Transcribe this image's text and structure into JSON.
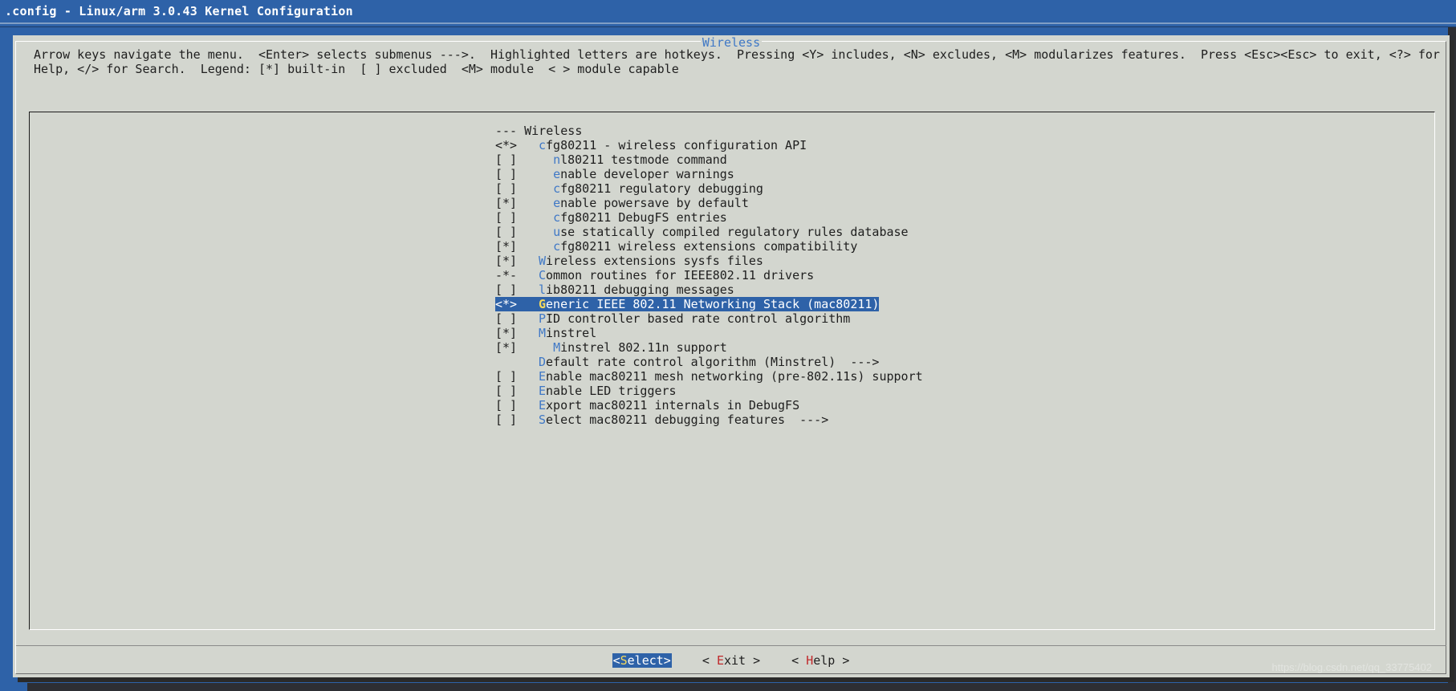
{
  "window": {
    "title": ".config - Linux/arm 3.0.43 Kernel Configuration"
  },
  "dialog": {
    "title": "Wireless",
    "help_line1": "Arrow keys navigate the menu.  <Enter> selects submenus --->.  Highlighted letters are hotkeys.  Pressing <Y> includes, <N> excludes, <M> modularizes features.  Press <Esc><Esc> to exit, <?> for",
    "help_line2": "Help, </> for Search.  Legend: [*] built-in  [ ] excluded  <M> module  < > module capable"
  },
  "menu": {
    "items": [
      {
        "state": "---",
        "indent": "",
        "hot": "",
        "text": "Wireless",
        "header": true
      },
      {
        "state": "<*>",
        "indent": "",
        "hot": "c",
        "text": "fg80211 - wireless configuration API"
      },
      {
        "state": "[ ]",
        "indent": "  ",
        "hot": "n",
        "text": "l80211 testmode command"
      },
      {
        "state": "[ ]",
        "indent": "  ",
        "hot": "e",
        "text": "nable developer warnings"
      },
      {
        "state": "[ ]",
        "indent": "  ",
        "hot": "c",
        "text": "fg80211 regulatory debugging"
      },
      {
        "state": "[*]",
        "indent": "  ",
        "hot": "e",
        "text": "nable powersave by default"
      },
      {
        "state": "[ ]",
        "indent": "  ",
        "hot": "c",
        "text": "fg80211 DebugFS entries"
      },
      {
        "state": "[ ]",
        "indent": "  ",
        "hot": "u",
        "text": "se statically compiled regulatory rules database"
      },
      {
        "state": "[*]",
        "indent": "  ",
        "hot": "c",
        "text": "fg80211 wireless extensions compatibility"
      },
      {
        "state": "[*]",
        "indent": "",
        "hot": "W",
        "text": "ireless extensions sysfs files"
      },
      {
        "state": "-*-",
        "indent": "",
        "hot": "C",
        "text": "ommon routines for IEEE802.11 drivers"
      },
      {
        "state": "[ ]",
        "indent": "",
        "hot": "l",
        "text": "ib80211 debugging messages"
      },
      {
        "state": "<*>",
        "indent": "",
        "hot": "G",
        "text": "eneric IEEE 802.11 Networking Stack (mac80211)",
        "selected": true
      },
      {
        "state": "[ ]",
        "indent": "",
        "hot": "P",
        "text": "ID controller based rate control algorithm"
      },
      {
        "state": "[*]",
        "indent": "",
        "hot": "M",
        "text": "instrel"
      },
      {
        "state": "[*]",
        "indent": "  ",
        "hot": "M",
        "text": "instrel 802.11n support"
      },
      {
        "state": "",
        "indent": "",
        "hot": "D",
        "text": "efault rate control algorithm (Minstrel)  --->"
      },
      {
        "state": "[ ]",
        "indent": "",
        "hot": "E",
        "text": "nable mac80211 mesh networking (pre-802.11s) support"
      },
      {
        "state": "[ ]",
        "indent": "",
        "hot": "E",
        "text": "nable LED triggers"
      },
      {
        "state": "[ ]",
        "indent": "",
        "hot": "E",
        "text": "xport mac80211 internals in DebugFS"
      },
      {
        "state": "[ ]",
        "indent": "",
        "hot": "S",
        "text": "elect mac80211 debugging features  --->"
      }
    ]
  },
  "buttons": {
    "select": {
      "pre": "<",
      "hot": "S",
      "post": "elect>"
    },
    "exit": {
      "pre": "< ",
      "hot": "E",
      "post": "xit >"
    },
    "help": {
      "pre": "< ",
      "hot": "H",
      "post": "elp >"
    }
  },
  "watermark": "https://blog.csdn.net/qq_33775402"
}
